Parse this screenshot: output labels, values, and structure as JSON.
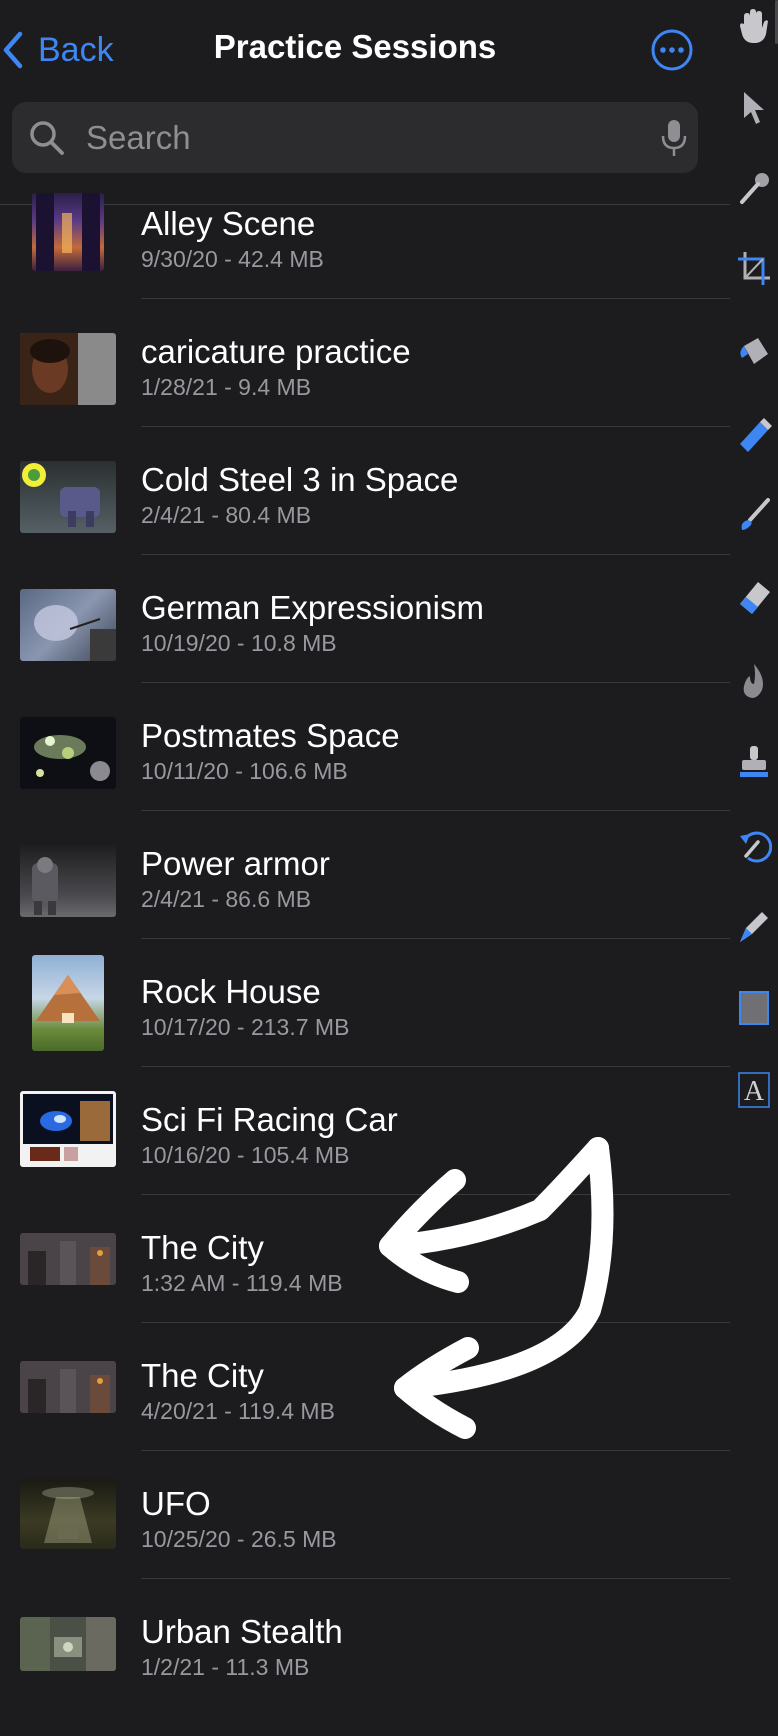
{
  "header": {
    "back_label": "Back",
    "title": "Practice Sessions"
  },
  "search": {
    "placeholder": "Search"
  },
  "sessions": [
    {
      "name": "Alley Scene",
      "meta": "9/30/20 - 42.4 MB"
    },
    {
      "name": "caricature practice",
      "meta": "1/28/21 - 9.4 MB"
    },
    {
      "name": "Cold Steel 3 in Space",
      "meta": "2/4/21 - 80.4 MB"
    },
    {
      "name": "German Expressionism",
      "meta": "10/19/20 - 10.8 MB"
    },
    {
      "name": "Postmates Space",
      "meta": "10/11/20 - 106.6 MB"
    },
    {
      "name": "Power armor",
      "meta": "2/4/21 - 86.6 MB"
    },
    {
      "name": "Rock House",
      "meta": "10/17/20 - 213.7 MB"
    },
    {
      "name": "Sci Fi Racing Car",
      "meta": "10/16/20 - 105.4 MB"
    },
    {
      "name": "The City",
      "meta": "1:32 AM - 119.4 MB"
    },
    {
      "name": "The City",
      "meta": "4/20/21 - 119.4 MB"
    },
    {
      "name": "UFO",
      "meta": "10/25/20 - 26.5 MB"
    },
    {
      "name": "Urban Stealth",
      "meta": "1/2/21 - 11.3 MB"
    }
  ],
  "toolbar": {
    "tools": [
      "hand-tool-icon",
      "pointer-tool-icon",
      "eyedropper-tool-icon",
      "crop-tool-icon",
      "paint-bucket-tool-icon",
      "pen-tool-icon",
      "brush-tool-icon",
      "eraser-tool-icon",
      "smudge-tool-icon",
      "clone-stamp-tool-icon",
      "history-brush-tool-icon",
      "pen-nib-tool-icon",
      "shape-tool-icon",
      "text-tool-icon"
    ]
  },
  "colors": {
    "background": "#1c1c1e",
    "accent": "#3d86f4",
    "secondary_text": "#98989f",
    "annotation": "#ffffff"
  }
}
